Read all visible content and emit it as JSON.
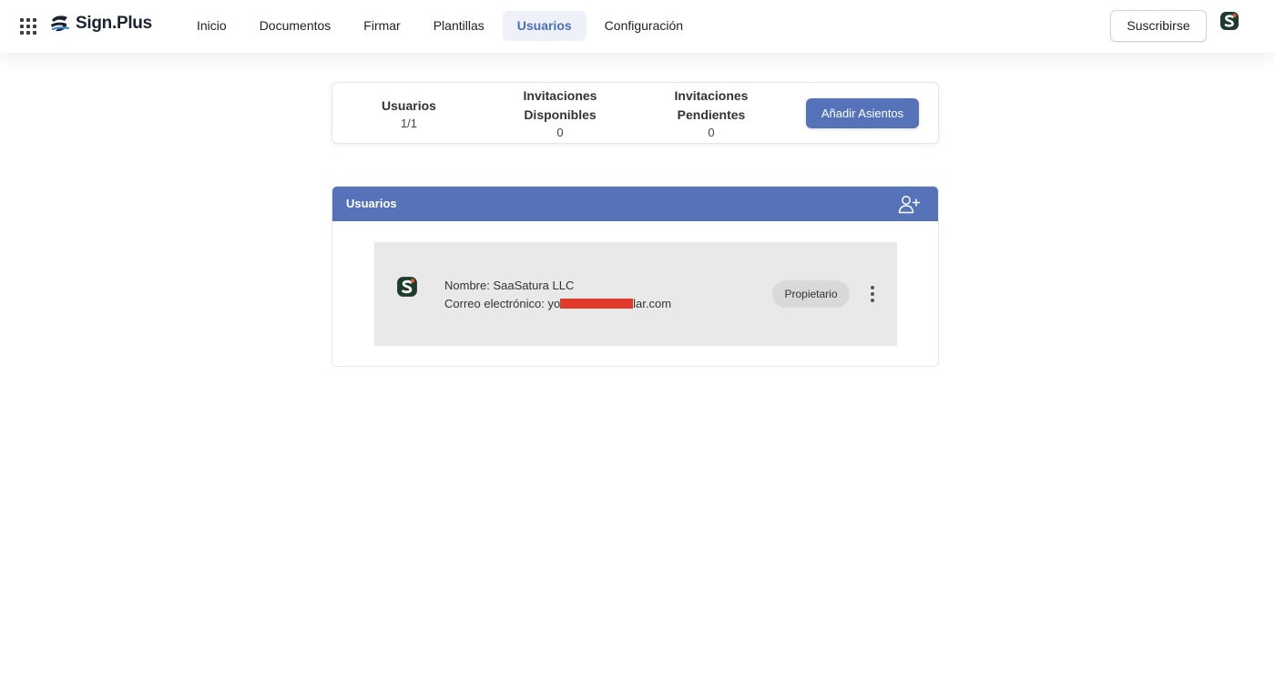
{
  "header": {
    "brand": "Sign.Plus",
    "nav": [
      {
        "label": "Inicio",
        "active": false
      },
      {
        "label": "Documentos",
        "active": false
      },
      {
        "label": "Firmar",
        "active": false
      },
      {
        "label": "Plantillas",
        "active": false
      },
      {
        "label": "Usuarios",
        "active": true
      },
      {
        "label": "Configuración",
        "active": false
      }
    ],
    "subscribe_label": "Suscribirse",
    "icons": {
      "apps": "apps-grid-icon",
      "avatar": "company-avatar-icon"
    }
  },
  "stats": {
    "users": {
      "label": "Usuarios",
      "value": "1/1"
    },
    "available": {
      "label": "Invitaciones Disponibles",
      "value": "0"
    },
    "pending": {
      "label": "Invitaciones Pendientes",
      "value": "0"
    },
    "add_seats_label": "Añadir Asientos"
  },
  "users_panel": {
    "title": "Usuarios",
    "add_icon": "add-user-icon",
    "users": [
      {
        "name_label": "Nombre: SaaSatura LLC",
        "email_prefix": "Correo electrónico: yo",
        "email_suffix": "lar.com",
        "role": "Propietario"
      }
    ]
  },
  "colors": {
    "accent": "#5673b9",
    "nav_active_bg": "#eef2f8",
    "row_bg": "#e9e9e9",
    "badge_bg": "#d9d9d9",
    "redaction": "#e23a2a"
  }
}
